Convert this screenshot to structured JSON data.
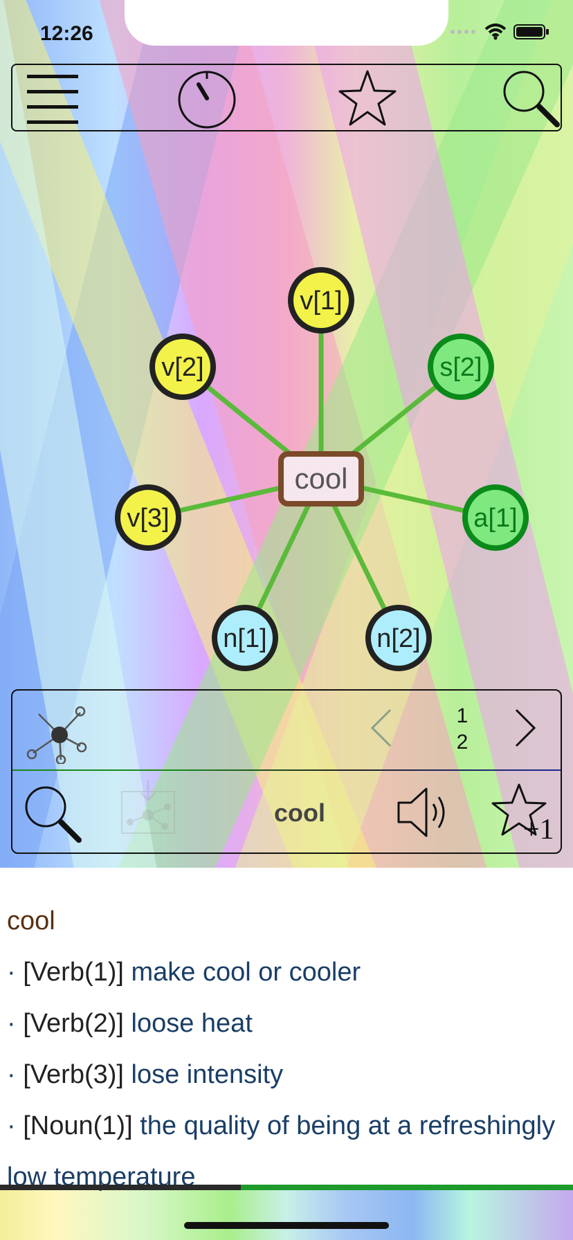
{
  "status_bar": {
    "time": "12:26"
  },
  "toolbar": {
    "buttons": [
      {
        "icon": "menu-icon"
      },
      {
        "icon": "timer-icon"
      },
      {
        "icon": "star-icon"
      },
      {
        "icon": "search-icon"
      }
    ]
  },
  "graph": {
    "center": "cool",
    "nodes": [
      "v[1]",
      "v[2]",
      "s[2]",
      "v[3]",
      "a[1]",
      "n[1]",
      "n[2]"
    ],
    "colors": {
      "verb": "#f2f24a",
      "adj": "#7fe97f",
      "noun": "#aeeefc",
      "edge": "#5aba3a",
      "center_border": "#7a4a2a"
    }
  },
  "panel": {
    "page": {
      "current": "1",
      "total": "2"
    },
    "word": "cool"
  },
  "definitions": {
    "word": "cool",
    "entries": [
      {
        "tag": "[Verb(1)]",
        "text": "make cool or cooler"
      },
      {
        "tag": "[Verb(2)]",
        "text": "loose heat"
      },
      {
        "tag": "[Verb(3)]",
        "text": "lose intensity"
      },
      {
        "tag": "[Noun(1)]",
        "text": "the quality of being at a refreshingly low temperature"
      }
    ]
  },
  "progress": {
    "fraction": 0.42
  }
}
